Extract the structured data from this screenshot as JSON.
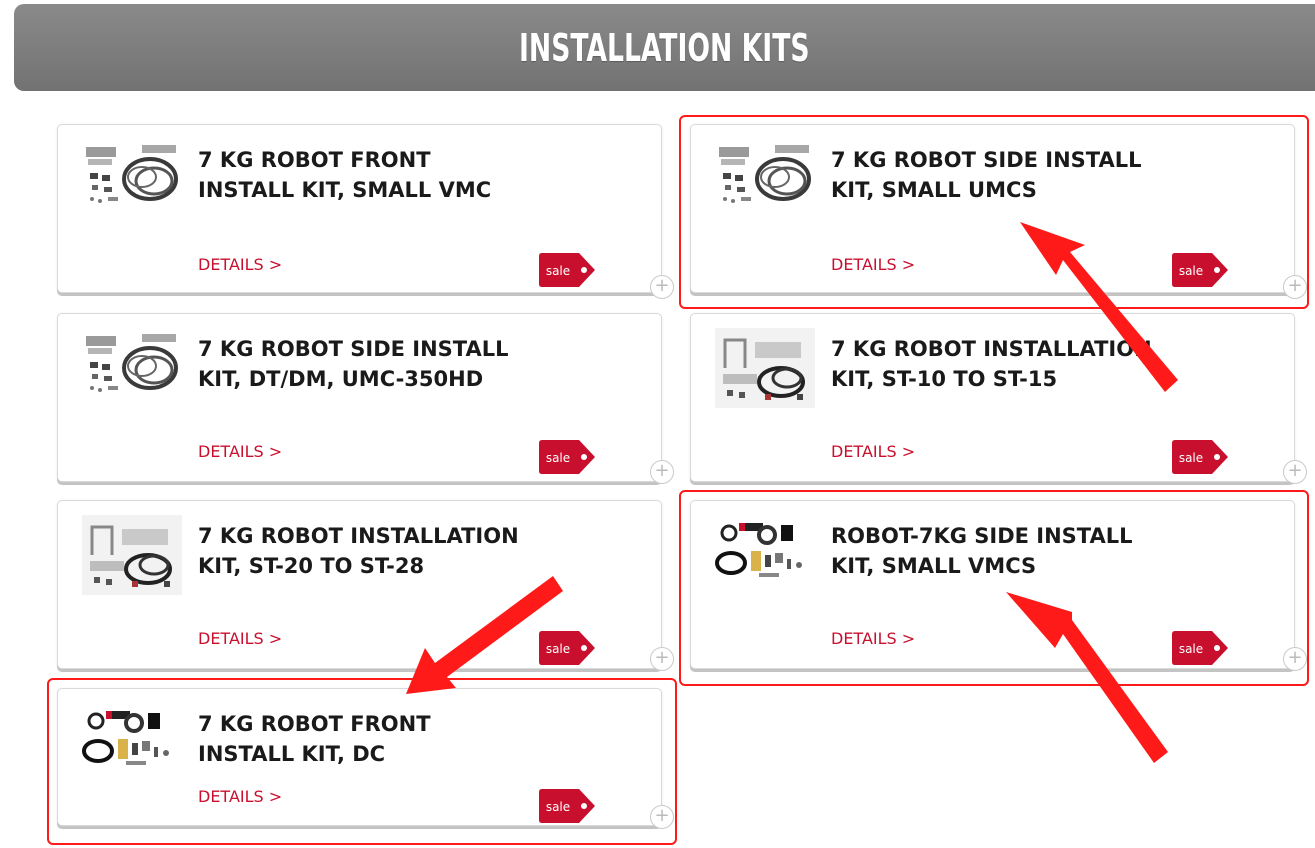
{
  "header": {
    "title": "INSTALLATION KITS"
  },
  "products": [
    {
      "title": "7 KG ROBOT FRONT INSTALL KIT, SMALL VMC",
      "details": "DETAILS >",
      "badge": "sale",
      "thumb": "cable-kit-gray"
    },
    {
      "title": "7 KG ROBOT SIDE INSTALL KIT, SMALL UMCS",
      "details": "DETAILS >",
      "badge": "sale",
      "thumb": "cable-kit-gray"
    },
    {
      "title": "7 KG ROBOT SIDE INSTALL KIT, DT/DM, UMC-350HD",
      "details": "DETAILS >",
      "badge": "sale",
      "thumb": "cable-kit-gray"
    },
    {
      "title": "7 KG ROBOT INSTALLATION KIT, ST-10 TO ST-15",
      "details": "DETAILS >",
      "badge": "sale",
      "thumb": "bracket-kit"
    },
    {
      "title": "7 KG ROBOT INSTALLATION KIT, ST-20 TO ST-28",
      "details": "DETAILS >",
      "badge": "sale",
      "thumb": "bracket-kit"
    },
    {
      "title": "ROBOT-7KG SIDE INSTALL KIT, SMALL VMCS",
      "details": "DETAILS >",
      "badge": "sale",
      "thumb": "parts-kit-black"
    },
    {
      "title": "7 KG ROBOT FRONT INSTALL KIT, DC",
      "details": "DETAILS >",
      "badge": "sale",
      "thumb": "parts-kit-black"
    }
  ],
  "colors": {
    "accent": "#c8102e",
    "highlight": "#ff1a1a",
    "header": "#7b7b7b"
  }
}
